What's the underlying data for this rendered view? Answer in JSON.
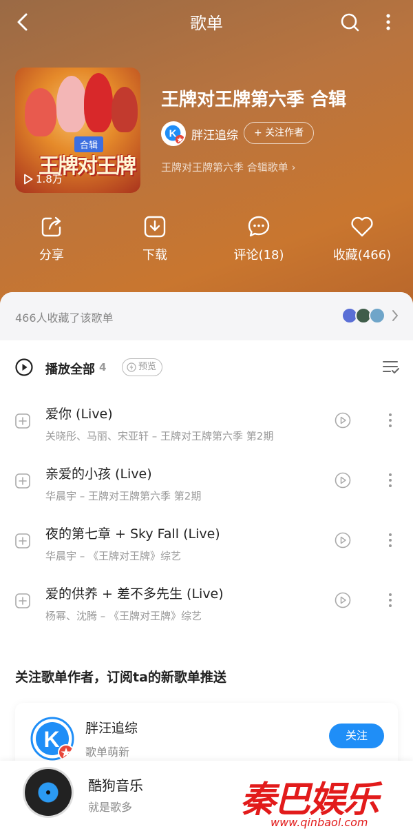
{
  "topbar": {
    "title": "歌单"
  },
  "cover": {
    "tag": "合辑",
    "logo_text": "王牌对王牌",
    "plays": "1.8万"
  },
  "playlist": {
    "title": "王牌对王牌第六季 合辑",
    "author": "胖汪追综",
    "follow_author": "+ 关注作者",
    "sub_link": "王牌对王牌第六季 合辑歌单 ›"
  },
  "actions": [
    {
      "label": "分享",
      "icon": "share-icon"
    },
    {
      "label": "下载",
      "icon": "download-icon"
    },
    {
      "label": "评论(18)",
      "icon": "comment-icon"
    },
    {
      "label": "收藏(466)",
      "icon": "heart-icon"
    }
  ],
  "favorites": {
    "text": "466人收藏了该歌单"
  },
  "play_all": {
    "label": "播放全部",
    "count": "4",
    "preview": "预览"
  },
  "songs": [
    {
      "name": "爱你 (Live)",
      "meta": "关晓彤、马丽、宋亚轩 – 王牌对王牌第六季 第2期"
    },
    {
      "name": "亲爱的小孩 (Live)",
      "meta": "华晨宇 – 王牌对王牌第六季 第2期"
    },
    {
      "name": "夜的第七章 + Sky Fall (Live)",
      "meta": "华晨宇 – 《王牌对王牌》综艺"
    },
    {
      "name": "爱的供养 + 差不多先生 (Live)",
      "meta": "杨幂、沈腾 – 《王牌对王牌》综艺"
    }
  ],
  "follow_section": {
    "heading": "关注歌单作者，订阅ta的新歌单推送",
    "name": "胖汪追综",
    "desc": "歌单萌新",
    "button": "关注"
  },
  "player": {
    "title": "酷狗音乐",
    "subtitle": "就是歌多"
  },
  "watermark": {
    "brand": "秦巴娱乐",
    "url": "www.qinbaol.com"
  },
  "colors": {
    "accent": "#1f8ef7",
    "hero": "#b9743f",
    "watermark": "#e21b1b"
  }
}
